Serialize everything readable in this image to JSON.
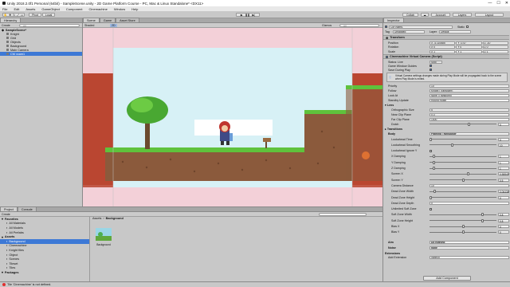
{
  "window": {
    "title": "Unity 2018.2.0f1 Personal (64bit) - SampleScene.unity - 2D Game Platform Course - PC, Mac & Linux Standalone* <DX11>",
    "minimize": "—",
    "maximize": "☐",
    "close": "✕"
  },
  "menu": [
    "File",
    "Edit",
    "Assets",
    "GameObject",
    "Component",
    "Cinemachine",
    "Window",
    "Help"
  ],
  "toolbar": {
    "pivot": "Pivot",
    "local": "Local",
    "collab": "Collab",
    "account": "Account",
    "layers": "Layers",
    "layout": "Layout"
  },
  "hierarchy": {
    "tab": "Hierarchy",
    "create": "Create",
    "search_placeholder": "All",
    "scene": "SampleScene*",
    "items": [
      {
        "label": "Knight",
        "indent": 1,
        "selected": false
      },
      {
        "label": "Grid",
        "indent": 1,
        "selected": false
      },
      {
        "label": "Objects",
        "indent": 1,
        "selected": false
      },
      {
        "label": "Background",
        "indent": 1,
        "selected": false
      },
      {
        "label": "Main Camera",
        "indent": 1,
        "selected": false
      },
      {
        "label": "CM vcam1",
        "indent": 1,
        "selected": true
      }
    ]
  },
  "scene": {
    "tabs": [
      "Scene",
      "Game",
      "Asset Store"
    ],
    "active_tab": "Scene",
    "shaded": "Shaded",
    "mode2d": "2D",
    "gizmos": "Gizmos",
    "search_placeholder": "All"
  },
  "inspector": {
    "tab": "Inspector",
    "object_name": "CM vcam1",
    "static": "Static",
    "tag_label": "Tag",
    "tag": "Untagged",
    "layer_label": "Layer",
    "layer": "Default",
    "transform": {
      "header": "Transform",
      "position": {
        "label": "Position",
        "x": "X -4.110685",
        "y": "Y -0.47",
        "z": "Z -10"
      },
      "rotation": {
        "label": "Rotation",
        "x": "X 0",
        "y": "Y 0",
        "z": "Z 0"
      },
      "scale": {
        "label": "Scale",
        "x": "X 1",
        "y": "Y 1",
        "z": "Z 1"
      }
    },
    "vcam": {
      "header": "Cinemachine Virtual Camera (Script)",
      "status_label": "Status: Live",
      "solo": "Solo",
      "game_window_guides": "Game Window Guides",
      "save_during_play": "Save During Play",
      "help_text": "Virtual Camera settings changes made during Play Mode will be propagated back to the scene when Play Mode is exited.",
      "priority": {
        "label": "Priority",
        "value": "10"
      },
      "follow": {
        "label": "Follow",
        "value": "Knight (Transform)"
      },
      "lookat": {
        "label": "Look At",
        "value": "None (Transform)"
      },
      "standby": {
        "label": "Standby Update",
        "value": "Round Robin"
      }
    },
    "lens": {
      "header": "Lens",
      "ortho": {
        "label": "Orthographic Size",
        "value": "5"
      },
      "near": {
        "label": "Near Clip Plane",
        "value": "0.3"
      },
      "far": {
        "label": "Far Clip Plane",
        "value": "1000"
      },
      "dutch": {
        "label": "Dutch",
        "value": "0"
      }
    },
    "transitions": "Transitions",
    "body": {
      "label": "Body",
      "value": "Framing Transposer",
      "fields": [
        {
          "label": "Lookahead Time",
          "value": "0",
          "pos": 0.0
        },
        {
          "label": "Lookahead Smoothing",
          "value": "10",
          "pos": 0.33
        },
        {
          "label": "Lookahead Ignore Y",
          "value": "",
          "pos": -1
        },
        {
          "label": "X Damping",
          "value": "1",
          "pos": 0.05
        },
        {
          "label": "Y Damping",
          "value": "1",
          "pos": 0.05
        },
        {
          "label": "Z Damping",
          "value": "1",
          "pos": 0.05
        },
        {
          "label": "Screen X",
          "value": "0.58849",
          "pos": 0.58
        },
        {
          "label": "Screen Y",
          "value": "0.5",
          "pos": 0.5
        },
        {
          "label": "Camera Distance",
          "value": "10",
          "pos": -1
        },
        {
          "label": "Dead Zone Width",
          "value": "0.06438",
          "pos": 0.06
        },
        {
          "label": "Dead Zone Height",
          "value": "0",
          "pos": 0.0
        },
        {
          "label": "Dead Zone Depth",
          "value": "0",
          "pos": -1
        },
        {
          "label": "Unlimited Soft Zone",
          "value": "",
          "pos": -1
        },
        {
          "label": "Soft Zone Width",
          "value": "0.8",
          "pos": 0.8
        },
        {
          "label": "Soft Zone Height",
          "value": "0.8",
          "pos": 0.8
        },
        {
          "label": "Bias X",
          "value": "0",
          "pos": 0.5
        },
        {
          "label": "Bias Y",
          "value": "0",
          "pos": 0.5
        }
      ]
    },
    "aim": {
      "label": "Aim",
      "value": "Do nothing"
    },
    "noise": {
      "label": "Noise",
      "value": "none"
    },
    "extensions": {
      "header": "Extensions",
      "add_label": "Add Extension",
      "add_value": "(select)"
    },
    "add_component": "Add Component"
  },
  "project": {
    "tabs": [
      "Project",
      "Console"
    ],
    "create": "Create",
    "breadcrumb": [
      "Assets",
      "Background"
    ],
    "tree": [
      {
        "label": "Favorites",
        "indent": 0,
        "bold": true
      },
      {
        "label": "All Materials",
        "indent": 1
      },
      {
        "label": "All Models",
        "indent": 1
      },
      {
        "label": "All Prefabs",
        "indent": 1
      },
      {
        "label": "Assets",
        "indent": 0,
        "bold": true
      },
      {
        "label": "Background",
        "indent": 1,
        "selected": true
      },
      {
        "label": "Cinemachine",
        "indent": 1
      },
      {
        "label": "Knight files",
        "indent": 1
      },
      {
        "label": "Object",
        "indent": 1
      },
      {
        "label": "Scenes",
        "indent": 1
      },
      {
        "label": "Tileset",
        "indent": 1
      },
      {
        "label": "Tiles",
        "indent": 1
      },
      {
        "label": "Packages",
        "indent": 0,
        "bold": true
      }
    ],
    "asset": "Background"
  },
  "status": {
    "message": "Tile 'Cinemachine' is not defined."
  },
  "colors": {
    "selection": "#3d79d6",
    "sky": "#d7f1f6",
    "deadzone_pink": "#f3d0d8",
    "softzone_red": "#b8432e",
    "grass": "#5fc23c",
    "dirt": "#8b5a3c"
  }
}
